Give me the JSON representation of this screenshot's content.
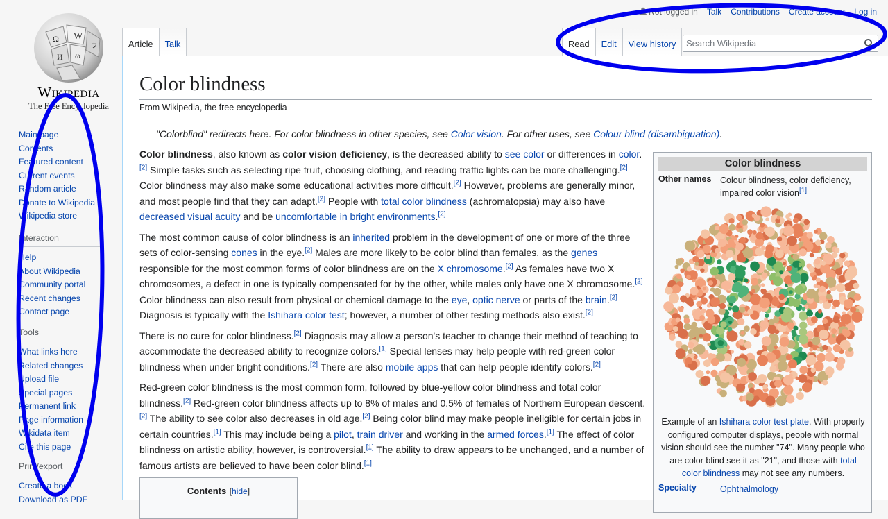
{
  "sidebar": {
    "logo": {
      "wordmark": "Wikipedia",
      "tagline": "The Free Encyclopedia",
      "globe_icon": "puzzle-globe-icon"
    },
    "nav_items": [
      "Main page",
      "Contents",
      "Featured content",
      "Current events",
      "Random article",
      "Donate to Wikipedia",
      "Wikipedia store"
    ],
    "interaction": {
      "heading": "Interaction",
      "items": [
        "Help",
        "About Wikipedia",
        "Community portal",
        "Recent changes",
        "Contact page"
      ]
    },
    "tools": {
      "heading": "Tools",
      "items": [
        "What links here",
        "Related changes",
        "Upload file",
        "Special pages",
        "Permanent link",
        "Page information",
        "Wikidata item",
        "Cite this page"
      ]
    },
    "print": {
      "heading": "Print/export",
      "items": [
        "Create a book",
        "Download as PDF"
      ]
    }
  },
  "personal": {
    "not_logged_in": "Not logged in",
    "links": [
      "Talk",
      "Contributions",
      "Create account",
      "Log in"
    ]
  },
  "tabs": {
    "left": [
      "Article",
      "Talk"
    ],
    "right": [
      "Read",
      "Edit",
      "View history"
    ]
  },
  "search": {
    "placeholder": "Search Wikipedia",
    "value": ""
  },
  "article": {
    "title": "Color blindness",
    "subtitle": "From Wikipedia, the free encyclopedia",
    "hatnote": {
      "t1": "\"Colorblind\" redirects here. For color blindness in other species, see ",
      "l1": "Color vision",
      "t2": ". For other uses, see ",
      "l2": "Colour blind (disambiguation)",
      "t3": "."
    },
    "paragraphs": [
      [
        {
          "t": "Color blindness",
          "b": true
        },
        {
          "t": ", also known as "
        },
        {
          "t": "color vision deficiency",
          "b": true
        },
        {
          "t": ", is the decreased ability to "
        },
        {
          "t": "see color",
          "l": true
        },
        {
          "t": " or differences in "
        },
        {
          "t": "color",
          "l": true
        },
        {
          "t": ".",
          "s": "[2]"
        },
        {
          "t": " Simple tasks such as selecting ripe fruit, choosing clothing, and reading traffic lights can be more challenging.",
          "s": "[2]"
        },
        {
          "t": " Color blindness may also make some educational activities more difficult.",
          "s": "[2]"
        },
        {
          "t": " However, problems are generally minor, and most people find that they can adapt.",
          "s": "[2]"
        },
        {
          "t": " People with "
        },
        {
          "t": "total color blindness",
          "l": true
        },
        {
          "t": " (achromatopsia) may also have "
        },
        {
          "t": "decreased visual acuity",
          "l": true
        },
        {
          "t": " and be "
        },
        {
          "t": "uncomfortable in bright environments",
          "l": true
        },
        {
          "t": ".",
          "s": "[2]"
        }
      ],
      [
        {
          "t": "The most common cause of color blindness is an "
        },
        {
          "t": "inherited",
          "l": true
        },
        {
          "t": " problem in the development of one or more of the three sets of color-sensing "
        },
        {
          "t": "cones",
          "l": true
        },
        {
          "t": " in the eye.",
          "s": "[2]"
        },
        {
          "t": " Males are more likely to be color blind than females, as the "
        },
        {
          "t": "genes",
          "l": true
        },
        {
          "t": " responsible for the most common forms of color blindness are on the "
        },
        {
          "t": "X chromosome",
          "l": true
        },
        {
          "t": ".",
          "s": "[2]"
        },
        {
          "t": " As females have two X chromosomes, a defect in one is typically compensated for by the other, while males only have one X chromosome.",
          "s": "[2]"
        },
        {
          "t": " Color blindness can also result from physical or chemical damage to the "
        },
        {
          "t": "eye",
          "l": true
        },
        {
          "t": ", "
        },
        {
          "t": "optic nerve",
          "l": true
        },
        {
          "t": " or parts of the "
        },
        {
          "t": "brain",
          "l": true
        },
        {
          "t": ".",
          "s": "[2]"
        },
        {
          "t": " Diagnosis is typically with the "
        },
        {
          "t": "Ishihara color test",
          "l": true
        },
        {
          "t": "; however, a number of other testing methods also exist.",
          "s": "[2]"
        }
      ],
      [
        {
          "t": "There is no cure for color blindness.",
          "s": "[2]"
        },
        {
          "t": " Diagnosis may allow a person's teacher to change their method of teaching to accommodate the decreased ability to recognize colors.",
          "s": "[1]"
        },
        {
          "t": " Special lenses may help people with red-green color blindness when under bright conditions.",
          "s": "[2]"
        },
        {
          "t": " There are also "
        },
        {
          "t": "mobile apps",
          "l": true
        },
        {
          "t": " that can help people identify colors.",
          "s": "[2]"
        }
      ],
      [
        {
          "t": "Red-green color blindness is the most common form, followed by blue-yellow color blindness and total color blindness.",
          "s": "[2]"
        },
        {
          "t": " Red-green color blindness affects up to 8% of males and 0.5% of females of Northern European descent.",
          "s": "[2]"
        },
        {
          "t": " The ability to see color also decreases in old age.",
          "s": "[2]"
        },
        {
          "t": " Being color blind may make people ineligible for certain jobs in certain countries.",
          "s": "[1]"
        },
        {
          "t": " This may include being a "
        },
        {
          "t": "pilot",
          "l": true
        },
        {
          "t": ", "
        },
        {
          "t": "train driver",
          "l": true
        },
        {
          "t": " and working in the "
        },
        {
          "t": "armed forces",
          "l": true
        },
        {
          "t": ".",
          "s": "[1]"
        },
        {
          "t": " The effect of color blindness on artistic ability, however, is controversial.",
          "s": "[1]"
        },
        {
          "t": " The ability to draw appears to be unchanged, and a number of famous artists are believed to have been color blind.",
          "s": "[1]"
        }
      ]
    ],
    "toc": {
      "title": "Contents",
      "toggle": "hide"
    }
  },
  "infobox": {
    "title": "Color blindness",
    "other_names_label": "Other names",
    "other_names_value": "Colour blindness, color deficiency, impaired color vision",
    "other_names_ref": "[1]",
    "caption": {
      "t1": "Example of an ",
      "l1": "Ishihara color test plate",
      "t2": ". With properly configured computer displays, people with normal vision should see the number \"74\". Many people who are color blind see it as \"21\", and those with ",
      "l2": "total color blindness",
      "t3": " may not see any numbers."
    },
    "specialty_label": "Specialty",
    "specialty_value": "Ophthalmology"
  },
  "colors": {
    "link": "#0645ad",
    "annotation": "#0000ee",
    "plate_background": [
      "#f3a07a",
      "#e8825a",
      "#f7b899",
      "#d9704b",
      "#f5c4a4",
      "#c9b07a"
    ],
    "plate_figure": [
      "#2e9b5e",
      "#4fb37a",
      "#8fbf6a",
      "#a9c77d",
      "#1f8a52"
    ]
  }
}
